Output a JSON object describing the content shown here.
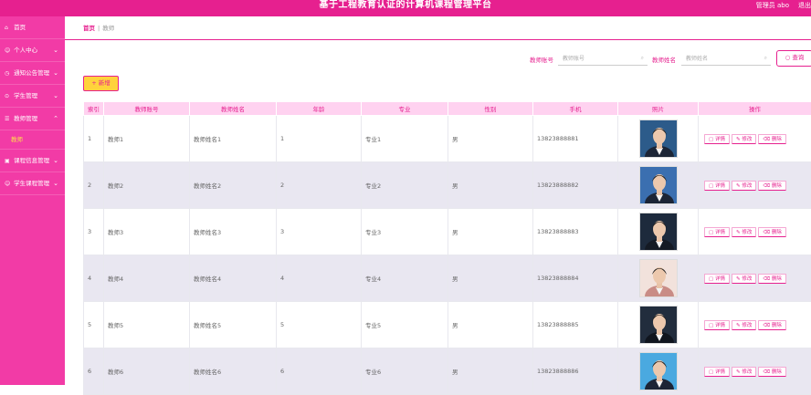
{
  "header": {
    "title": "基于工程教育认证的计算机课程管理平台",
    "user": "管理员 abo",
    "logout": "退出"
  },
  "sidebar": {
    "items": [
      {
        "label": "首页",
        "icon": "home-icon"
      },
      {
        "label": "个人中心",
        "icon": "user-icon"
      },
      {
        "label": "通知公告管理",
        "icon": "notice-icon"
      },
      {
        "label": "学生管理",
        "icon": "student-icon"
      },
      {
        "label": "教师管理",
        "icon": "teacher-icon"
      },
      {
        "label": "课程信息管理",
        "icon": "course-icon"
      },
      {
        "label": "学生课程管理",
        "icon": "student-course-icon"
      }
    ],
    "active_sub": "教师"
  },
  "breadcrumb": {
    "home": "首页",
    "current": "教师"
  },
  "search": {
    "field1_label": "教师账号",
    "field1_placeholder": "教师账号",
    "field2_label": "教师姓名",
    "field2_placeholder": "教师姓名",
    "button": "查询"
  },
  "add_button": "+ 新增",
  "table": {
    "columns": [
      "索引",
      "教师账号",
      "教师姓名",
      "年龄",
      "专业",
      "性别",
      "手机",
      "照片",
      "操作"
    ],
    "rows": [
      {
        "idx": "1",
        "account": "教师1",
        "name": "教师姓名1",
        "age": "1",
        "major": "专业1",
        "gender": "男",
        "phone": "13823888881"
      },
      {
        "idx": "2",
        "account": "教师2",
        "name": "教师姓名2",
        "age": "2",
        "major": "专业2",
        "gender": "男",
        "phone": "13823888882"
      },
      {
        "idx": "3",
        "account": "教师3",
        "name": "教师姓名3",
        "age": "3",
        "major": "专业3",
        "gender": "男",
        "phone": "13823888883"
      },
      {
        "idx": "4",
        "account": "教师4",
        "name": "教师姓名4",
        "age": "4",
        "major": "专业4",
        "gender": "男",
        "phone": "13823888884"
      },
      {
        "idx": "5",
        "account": "教师5",
        "name": "教师姓名5",
        "age": "5",
        "major": "专业5",
        "gender": "男",
        "phone": "13823888885"
      },
      {
        "idx": "6",
        "account": "教师6",
        "name": "教师姓名6",
        "age": "6",
        "major": "专业6",
        "gender": "男",
        "phone": "13823888886"
      }
    ],
    "actions": {
      "detail": "详情",
      "edit": "修改",
      "delete": "删除"
    }
  },
  "colors": {
    "accent": "#e6208f",
    "sidebar": "#f23ba6",
    "header_row": "#ffd2f0",
    "add_button": "#ffd23c"
  }
}
